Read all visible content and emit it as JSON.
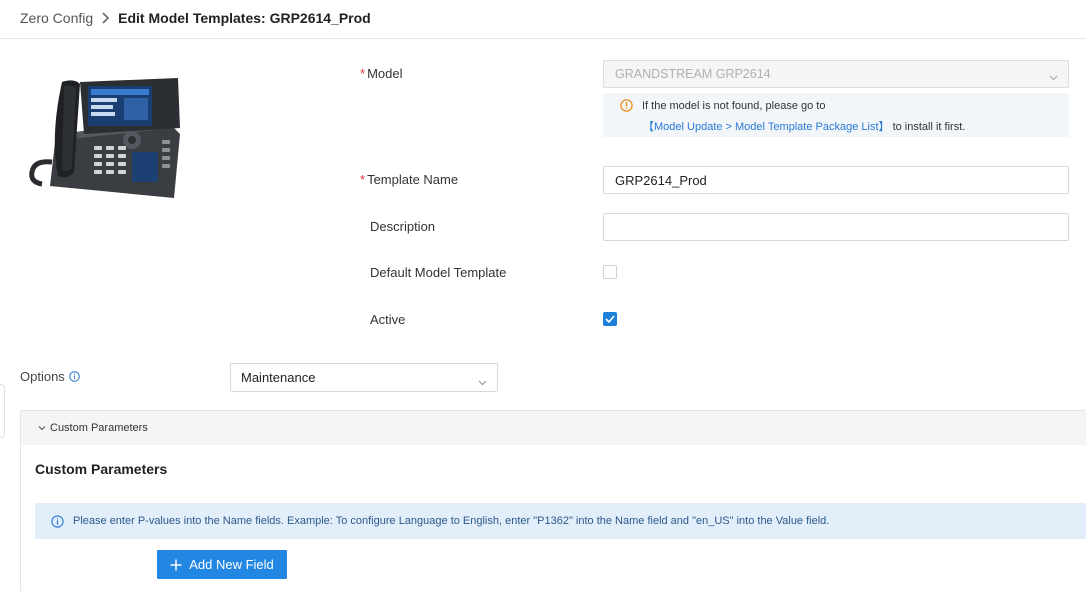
{
  "breadcrumb": {
    "root": "Zero Config",
    "current": "Edit Model Templates: GRP2614_Prod"
  },
  "form": {
    "model": {
      "label": "Model",
      "required": "*",
      "value": "GRANDSTREAM GRP2614"
    },
    "notice": {
      "line1": "If the model is not found, please go to",
      "link": "【Model Update > Model Template Package List】",
      "suffix": " to install it first."
    },
    "template_name": {
      "label": "Template Name",
      "required": "*",
      "value": "GRP2614_Prod"
    },
    "description": {
      "label": "Description",
      "value": ""
    },
    "default_model_template": {
      "label": "Default Model Template",
      "checked": false
    },
    "active": {
      "label": "Active",
      "checked": true
    }
  },
  "options": {
    "label": "Options",
    "selected": "Maintenance"
  },
  "custom_parameters": {
    "header": "Custom Parameters",
    "title": "Custom Parameters",
    "info": "Please enter P-values into the Name fields. Example: To configure Language to English, enter \"P1362\" into the Name field and \"en_US\" into the Value field.",
    "add_button": "Add New Field"
  },
  "colors": {
    "primary": "#2286e3",
    "checkbox_checked": "#1e7fd9",
    "required": "#e53935",
    "link": "#2a7ad6",
    "warning": "#f08c1e",
    "info_bg": "#e3eefb"
  },
  "icons": [
    "chevron-right-icon",
    "chevron-down-icon",
    "warning-circle-icon",
    "info-icon",
    "check-icon",
    "plus-icon",
    "phone-image"
  ]
}
